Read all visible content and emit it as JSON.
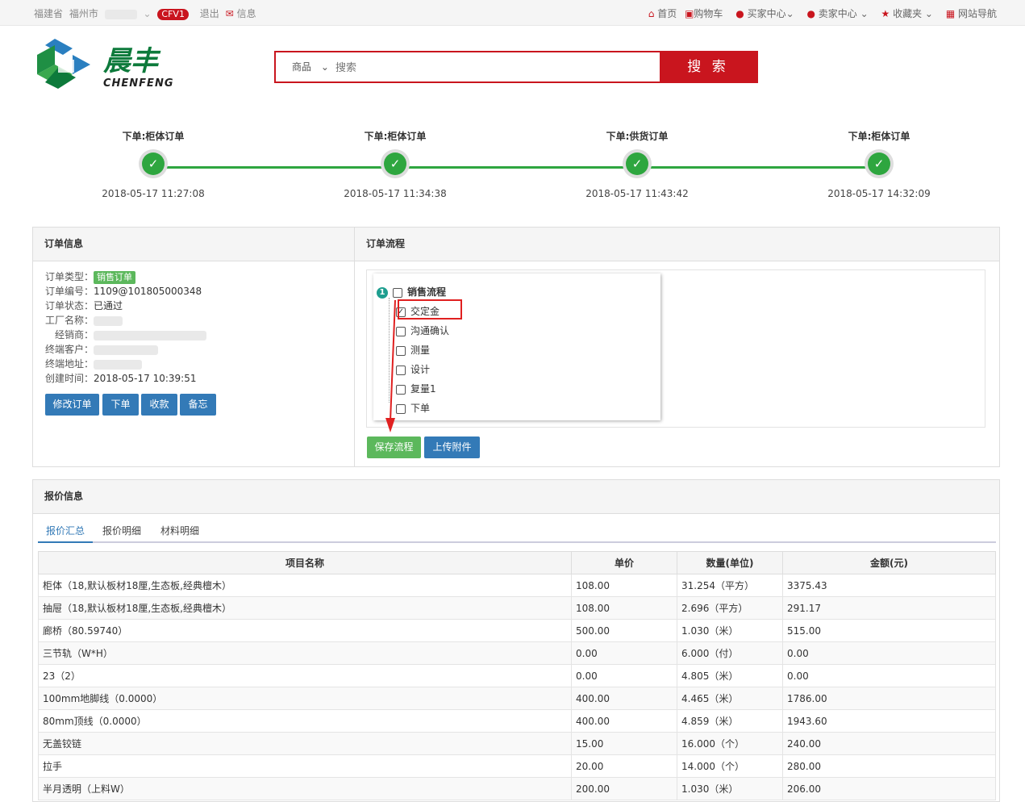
{
  "topbar": {
    "province": "福建省",
    "city": "福州市",
    "cfv": "CFV1",
    "logout": "退出",
    "message": "信息",
    "nav": [
      {
        "label": "首页",
        "icon": "home-icon"
      },
      {
        "label": "购物车",
        "icon": "cart-icon"
      },
      {
        "label": "买家中心",
        "icon": "user-icon"
      },
      {
        "label": "卖家中心",
        "icon": "user-icon"
      },
      {
        "label": "收藏夹",
        "icon": "star-icon"
      },
      {
        "label": "网站导航",
        "icon": "sitemap-icon"
      }
    ]
  },
  "logo": {
    "cn": "晨丰",
    "en": "CHENFENG"
  },
  "search": {
    "category": "商品",
    "placeholder": "搜索",
    "button": "搜 索"
  },
  "steps": [
    {
      "label": "下单:柜体订单",
      "time": "2018-05-17 11:27:08"
    },
    {
      "label": "下单:柜体订单",
      "time": "2018-05-17 11:34:38"
    },
    {
      "label": "下单:供货订单",
      "time": "2018-05-17 11:43:42"
    },
    {
      "label": "下单:柜体订单",
      "time": "2018-05-17 14:32:09"
    }
  ],
  "order": {
    "title": "订单信息",
    "type_k": "订单类型：",
    "type_v": "销售订单",
    "no_k": "订单编号：",
    "no_v": "1109@101805000348",
    "status_k": "订单状态：",
    "status_v": "已通过",
    "factory_k": "工厂名称：",
    "dealer_k": "经销商：",
    "customer_k": "终端客户：",
    "address_k": "终端地址：",
    "created_k": "创建时间：",
    "created_v": "2018-05-17 10:39:51",
    "buttons": [
      "修改订单",
      "下单",
      "收款",
      "备忘"
    ]
  },
  "flow": {
    "title": "订单流程",
    "root": "销售流程",
    "root_num": "1",
    "items": [
      {
        "label": "交定金",
        "checked": true
      },
      {
        "label": "沟通确认",
        "checked": false
      },
      {
        "label": "测量",
        "checked": false
      },
      {
        "label": "设计",
        "checked": false
      },
      {
        "label": "复量1",
        "checked": false
      },
      {
        "label": "下单",
        "checked": false
      }
    ],
    "save": "保存流程",
    "upload": "上传附件"
  },
  "quote": {
    "title": "报价信息",
    "tabs": [
      "报价汇总",
      "报价明细",
      "材料明细"
    ],
    "headers": [
      "项目名称",
      "单价",
      "数量(单位)",
      "金额(元)"
    ],
    "rows": [
      [
        "柜体（18,默认板材18厘,生态板,经典檀木）",
        "108.00",
        "31.254（平方）",
        "3375.43"
      ],
      [
        "抽屉（18,默认板材18厘,生态板,经典檀木）",
        "108.00",
        "2.696（平方）",
        "291.17"
      ],
      [
        "廊桥（80.59740）",
        "500.00",
        "1.030（米）",
        "515.00"
      ],
      [
        "三节轨（W*H）",
        "0.00",
        "6.000（付）",
        "0.00"
      ],
      [
        "23（2）",
        "0.00",
        "4.805（米）",
        "0.00"
      ],
      [
        "100mm地脚线（0.0000）",
        "400.00",
        "4.465（米）",
        "1786.00"
      ],
      [
        "80mm顶线（0.0000）",
        "400.00",
        "4.859（米）",
        "1943.60"
      ],
      [
        "无盖铰链",
        "15.00",
        "16.000（个）",
        "240.00"
      ],
      [
        "拉手",
        "20.00",
        "14.000（个）",
        "280.00"
      ],
      [
        "半月透明（上料W）",
        "200.00",
        "1.030（米）",
        "206.00"
      ]
    ]
  }
}
